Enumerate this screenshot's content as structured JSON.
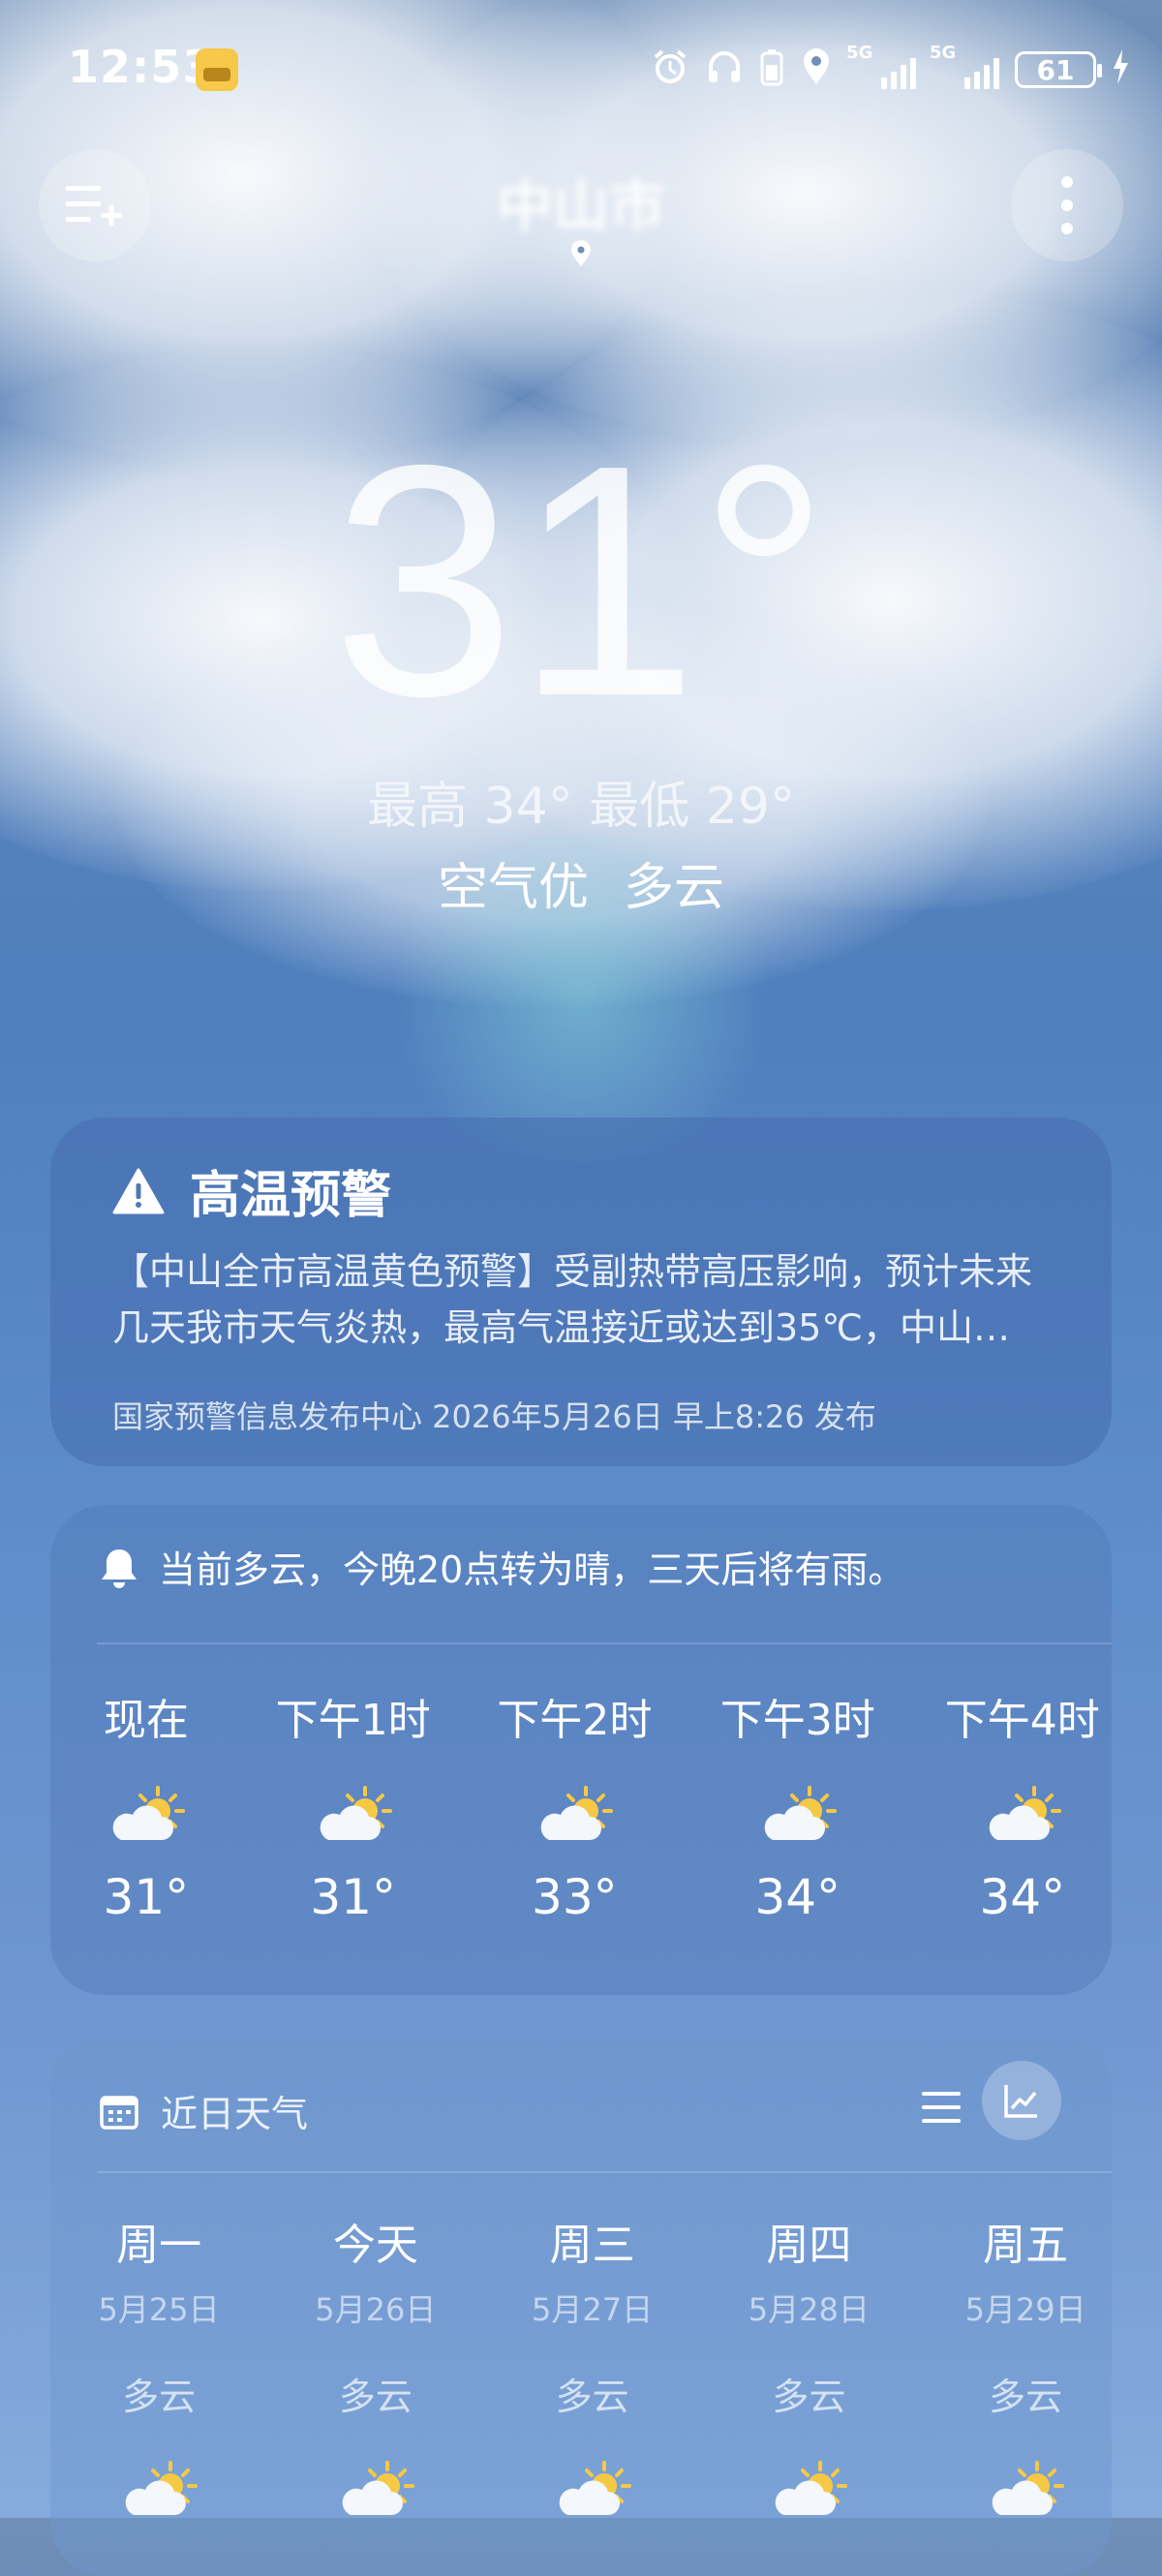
{
  "status_bar": {
    "time": "12:53",
    "network_1": "5G",
    "network_2": "5G",
    "battery": "61"
  },
  "header": {
    "city": "中山市"
  },
  "current": {
    "temperature": "31°",
    "high_low": "最高 34° 最低 29°",
    "air_quality": "空气优",
    "condition": "多云"
  },
  "warning": {
    "title": "高温预警",
    "body": "【中山全市高温黄色预警】受副热带高压影响，预计未来几天我市天气炎热，最高气温接近或达到35℃，中山…",
    "source": "国家预警信息发布中心 2026年5月26日 早上8:26 发布"
  },
  "hourly": {
    "notice": "当前多云，今晚20点转为晴，三天后将有雨。",
    "items": [
      {
        "label": "现在",
        "icon": "partly-cloudy-icon",
        "temp": "31°"
      },
      {
        "label": "下午1时",
        "icon": "partly-cloudy-icon",
        "temp": "31°"
      },
      {
        "label": "下午2时",
        "icon": "partly-cloudy-icon",
        "temp": "33°"
      },
      {
        "label": "下午3时",
        "icon": "partly-cloudy-icon",
        "temp": "34°"
      },
      {
        "label": "下午4时",
        "icon": "partly-cloudy-icon",
        "temp": "34°"
      }
    ]
  },
  "daily": {
    "title": "近日天气",
    "items": [
      {
        "name": "周一",
        "date": "5月25日",
        "condition": "多云",
        "icon": "partly-cloudy-icon"
      },
      {
        "name": "今天",
        "date": "5月26日",
        "condition": "多云",
        "icon": "partly-cloudy-icon"
      },
      {
        "name": "周三",
        "date": "5月27日",
        "condition": "多云",
        "icon": "partly-cloudy-icon"
      },
      {
        "name": "周四",
        "date": "5月28日",
        "condition": "多云",
        "icon": "partly-cloudy-icon"
      },
      {
        "name": "周五",
        "date": "5月29日",
        "condition": "多云",
        "icon": "partly-cloudy-icon"
      }
    ]
  },
  "colors": {
    "sky_top": "#6f8fb8",
    "sky_bottom": "#86abdc",
    "sun": "#f6c945"
  }
}
